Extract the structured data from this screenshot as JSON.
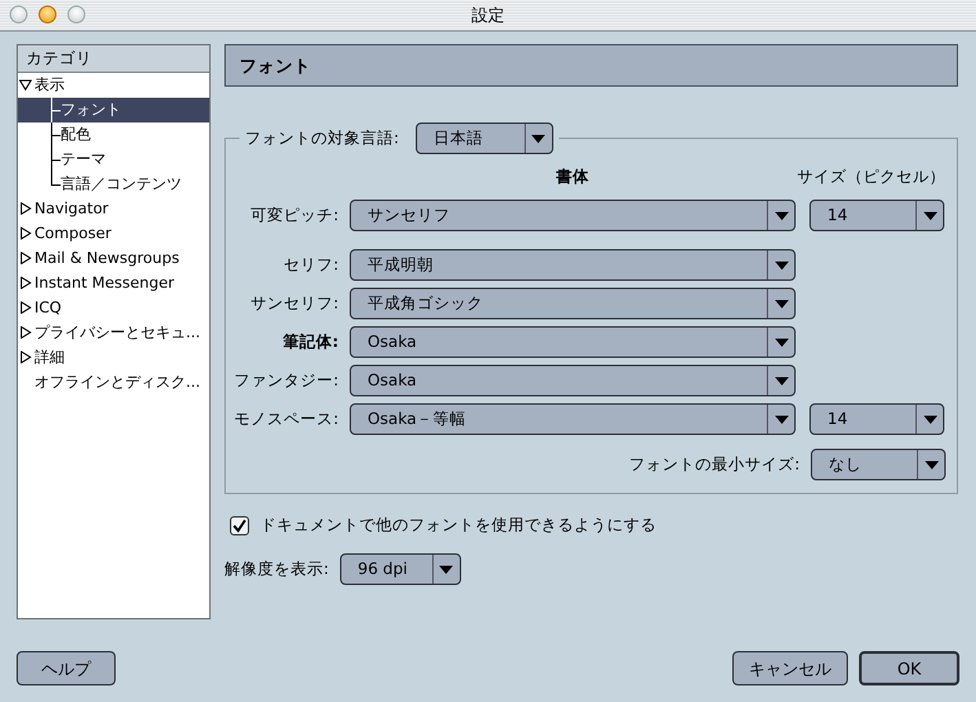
{
  "window": {
    "title": "設定"
  },
  "sidebar": {
    "header": "カテゴリ",
    "items": [
      {
        "label": "表示",
        "expanded": true,
        "selected": false,
        "children": [
          {
            "label": "フォント",
            "selected": true
          },
          {
            "label": "配色",
            "selected": false
          },
          {
            "label": "テーマ",
            "selected": false
          },
          {
            "label": "言語／コンテンツ",
            "selected": false
          }
        ]
      },
      {
        "label": "Navigator",
        "expanded": false,
        "selected": false
      },
      {
        "label": "Composer",
        "expanded": false,
        "selected": false
      },
      {
        "label": "Mail & Newsgroups",
        "expanded": false,
        "selected": false
      },
      {
        "label": "Instant Messenger",
        "expanded": false,
        "selected": false
      },
      {
        "label": "ICQ",
        "expanded": false,
        "selected": false
      },
      {
        "label": "プライバシーとセキュ...",
        "expanded": false,
        "selected": false
      },
      {
        "label": "詳細",
        "expanded": false,
        "selected": false
      },
      {
        "label": "オフラインとディスク...",
        "selected": false
      }
    ]
  },
  "panel": {
    "title": "フォント",
    "language": {
      "label": "フォントの対象言語:",
      "value": "日本語"
    },
    "columns": [
      "書体",
      "サイズ（ピクセル）"
    ],
    "font_rows": [
      {
        "label": "可変ピッチ:",
        "value": "サンセリフ",
        "size": "14",
        "emphasized": false
      },
      {
        "label": "セリフ:",
        "value": "平成明朝",
        "emphasized": false
      },
      {
        "label": "サンセリフ:",
        "value": "平成角ゴシック",
        "emphasized": false
      },
      {
        "label": "筆記体:",
        "value": "Osaka",
        "emphasized": true
      },
      {
        "label": "ファンタジー:",
        "value": "Osaka",
        "emphasized": false
      },
      {
        "label": "モノスペース:",
        "value": "Osaka－等幅",
        "size": "14",
        "emphasized": false
      }
    ],
    "min_size": {
      "label": "フォントの最小サイズ:",
      "value": "なし"
    },
    "allow_fonts": {
      "label": "ドキュメントで他のフォントを使用できるようにする",
      "checked": true
    },
    "resolution": {
      "label": "解像度を表示:",
      "value": "96 dpi"
    }
  },
  "buttons": [
    {
      "label": "ヘルプ",
      "kind": "help",
      "default": false
    },
    {
      "label": "キャンセル",
      "kind": "action",
      "default": false
    },
    {
      "label": "OK",
      "kind": "action",
      "default": true
    }
  ]
}
